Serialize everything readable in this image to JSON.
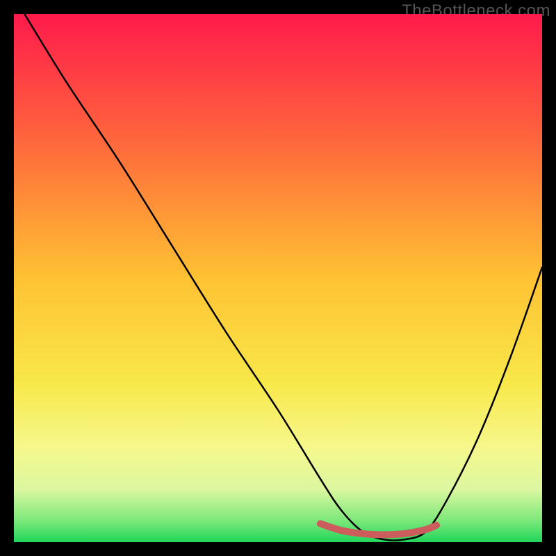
{
  "watermark": "TheBottleneck.com",
  "chart_data": {
    "type": "line",
    "title": "",
    "xlabel": "",
    "ylabel": "",
    "xlim": [
      0,
      100
    ],
    "ylim": [
      0,
      100
    ],
    "grid": false,
    "legend": false,
    "series": [
      {
        "name": "curve",
        "x": [
          2,
          10,
          20,
          30,
          40,
          50,
          58,
          62,
          66,
          70,
          74,
          78,
          82,
          88,
          94,
          100
        ],
        "y": [
          100,
          87,
          72,
          56,
          40,
          25,
          12,
          6,
          2,
          0.5,
          0.5,
          2,
          8,
          20,
          35,
          52
        ],
        "color": "#000000"
      },
      {
        "name": "bump",
        "x": [
          58,
          62,
          66,
          70,
          74,
          78,
          80
        ],
        "y": [
          3.5,
          2.2,
          1.6,
          1.4,
          1.6,
          2.4,
          3.2
        ],
        "color": "#cd5c5c"
      }
    ],
    "background_gradient": {
      "stops": [
        {
          "offset": 0.0,
          "color": "#ff1a4b"
        },
        {
          "offset": 0.25,
          "color": "#ff6a3c"
        },
        {
          "offset": 0.5,
          "color": "#ffc233"
        },
        {
          "offset": 0.7,
          "color": "#f8e84a"
        },
        {
          "offset": 0.82,
          "color": "#f6f88c"
        },
        {
          "offset": 0.9,
          "color": "#dcf7a0"
        },
        {
          "offset": 0.96,
          "color": "#7be87a"
        },
        {
          "offset": 1.0,
          "color": "#1fd65a"
        }
      ]
    }
  }
}
